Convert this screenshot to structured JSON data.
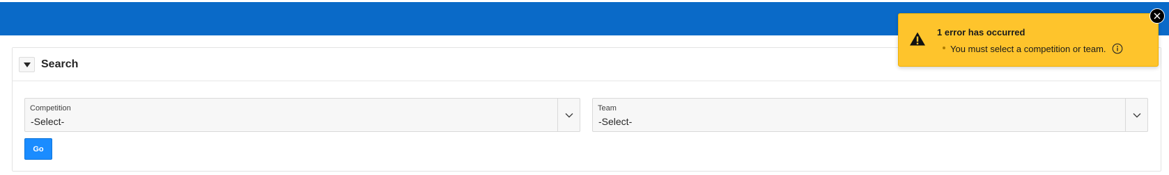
{
  "colors": {
    "header_bar": "#0a6ac8",
    "go_button": "#1a8cff",
    "notification_bg": "#fec42c"
  },
  "search_region": {
    "title": "Search",
    "toggle_icon": "triangle-down-icon",
    "competition": {
      "label": "Competition",
      "value": "-Select-",
      "icon": "chevron-down-icon"
    },
    "team": {
      "label": "Team",
      "value": "-Select-",
      "icon": "chevron-down-icon"
    },
    "go_label": "Go"
  },
  "notification": {
    "icon": "warning-icon",
    "title": "1 error has occurred",
    "messages": [
      {
        "text": "You must select a competition or team.",
        "icon": "info-icon"
      }
    ],
    "close_icon": "close-icon"
  }
}
